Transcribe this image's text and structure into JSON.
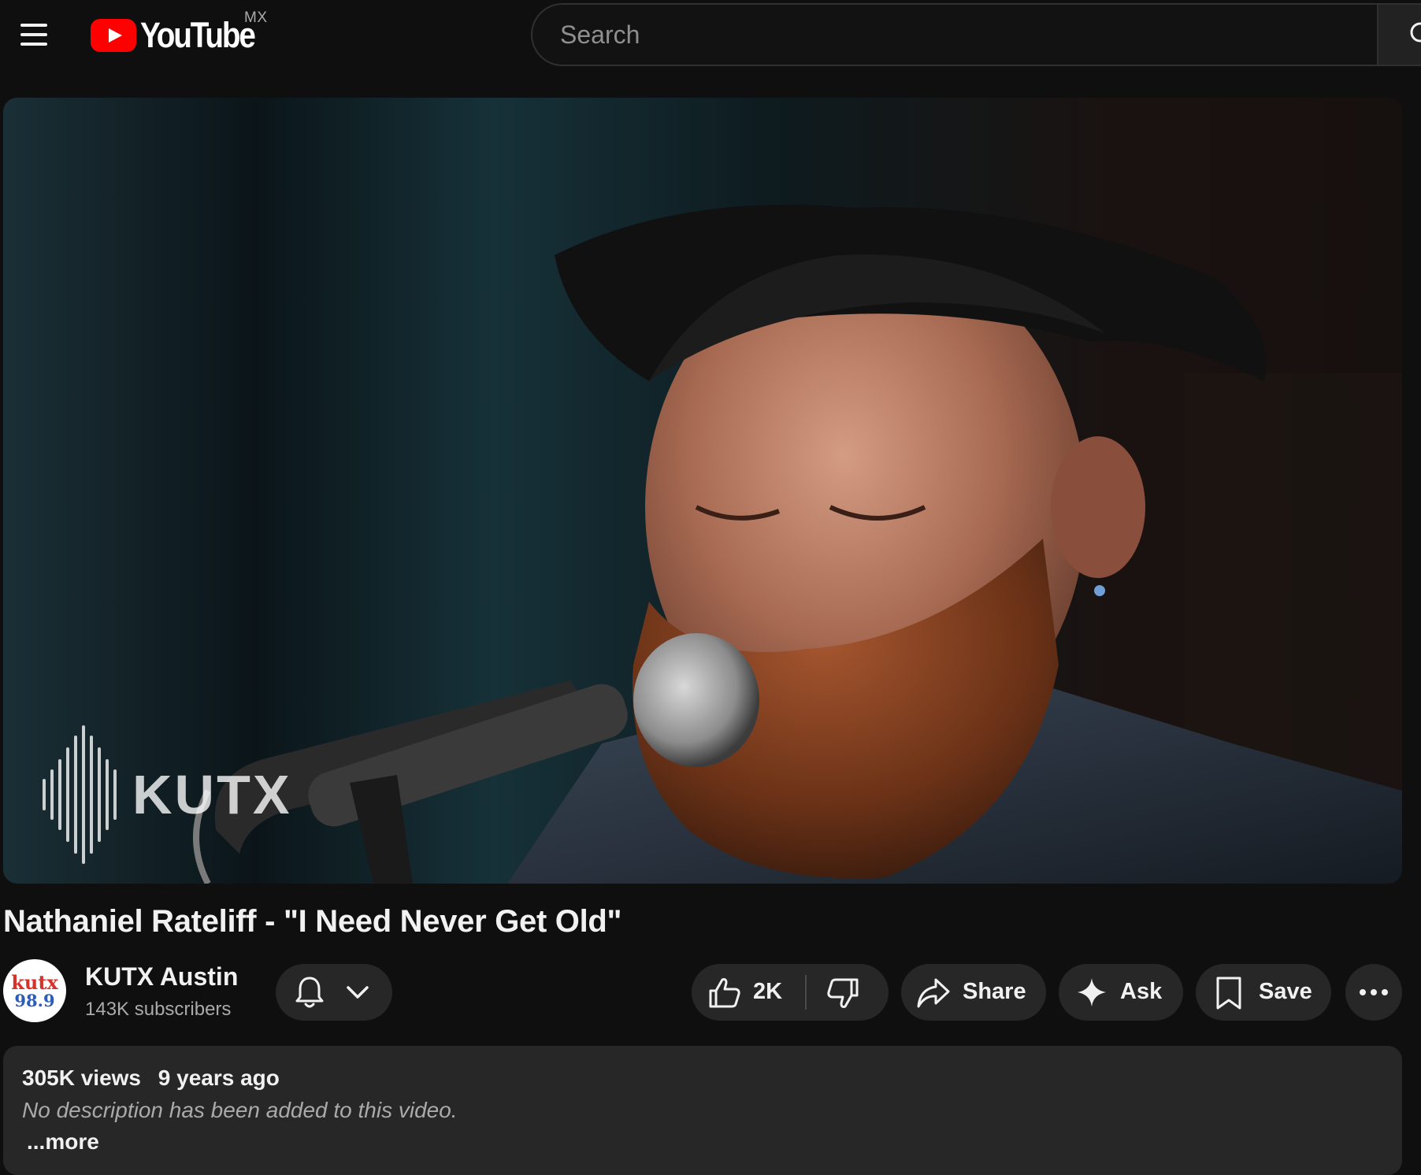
{
  "header": {
    "logo_text": "YouTube",
    "region": "MX",
    "search_placeholder": "Search",
    "icons": {
      "menu": "hamburger-menu-icon",
      "logo": "youtube-play-icon",
      "search": "search-icon"
    }
  },
  "player": {
    "watermark": "KUTX"
  },
  "video": {
    "title": "Nathaniel Rateliff - \"I Need Never Get Old\""
  },
  "channel": {
    "avatar_top": "kutx",
    "avatar_bottom": "98.9",
    "name": "KUTX Austin",
    "subscribers": "143K subscribers"
  },
  "actions": {
    "like_count": "2K",
    "share_label": "Share",
    "ask_label": "Ask",
    "save_label": "Save",
    "icons": {
      "bell": "bell-icon",
      "chevron": "chevron-down-icon",
      "like": "thumbs-up-icon",
      "dislike": "thumbs-down-icon",
      "share": "share-arrow-icon",
      "ask": "sparkle-icon",
      "save": "bookmark-icon",
      "more": "more-horizontal-icon"
    }
  },
  "description": {
    "views": "305K views",
    "age": "9 years ago",
    "text": "No description has been added to this video.",
    "more_label": "...more"
  },
  "colors": {
    "background": "#0f0f0f",
    "pill": "#272727",
    "brand_red": "#ff0000",
    "text_primary": "#f1f1f1",
    "text_secondary": "#aaaaaa"
  }
}
